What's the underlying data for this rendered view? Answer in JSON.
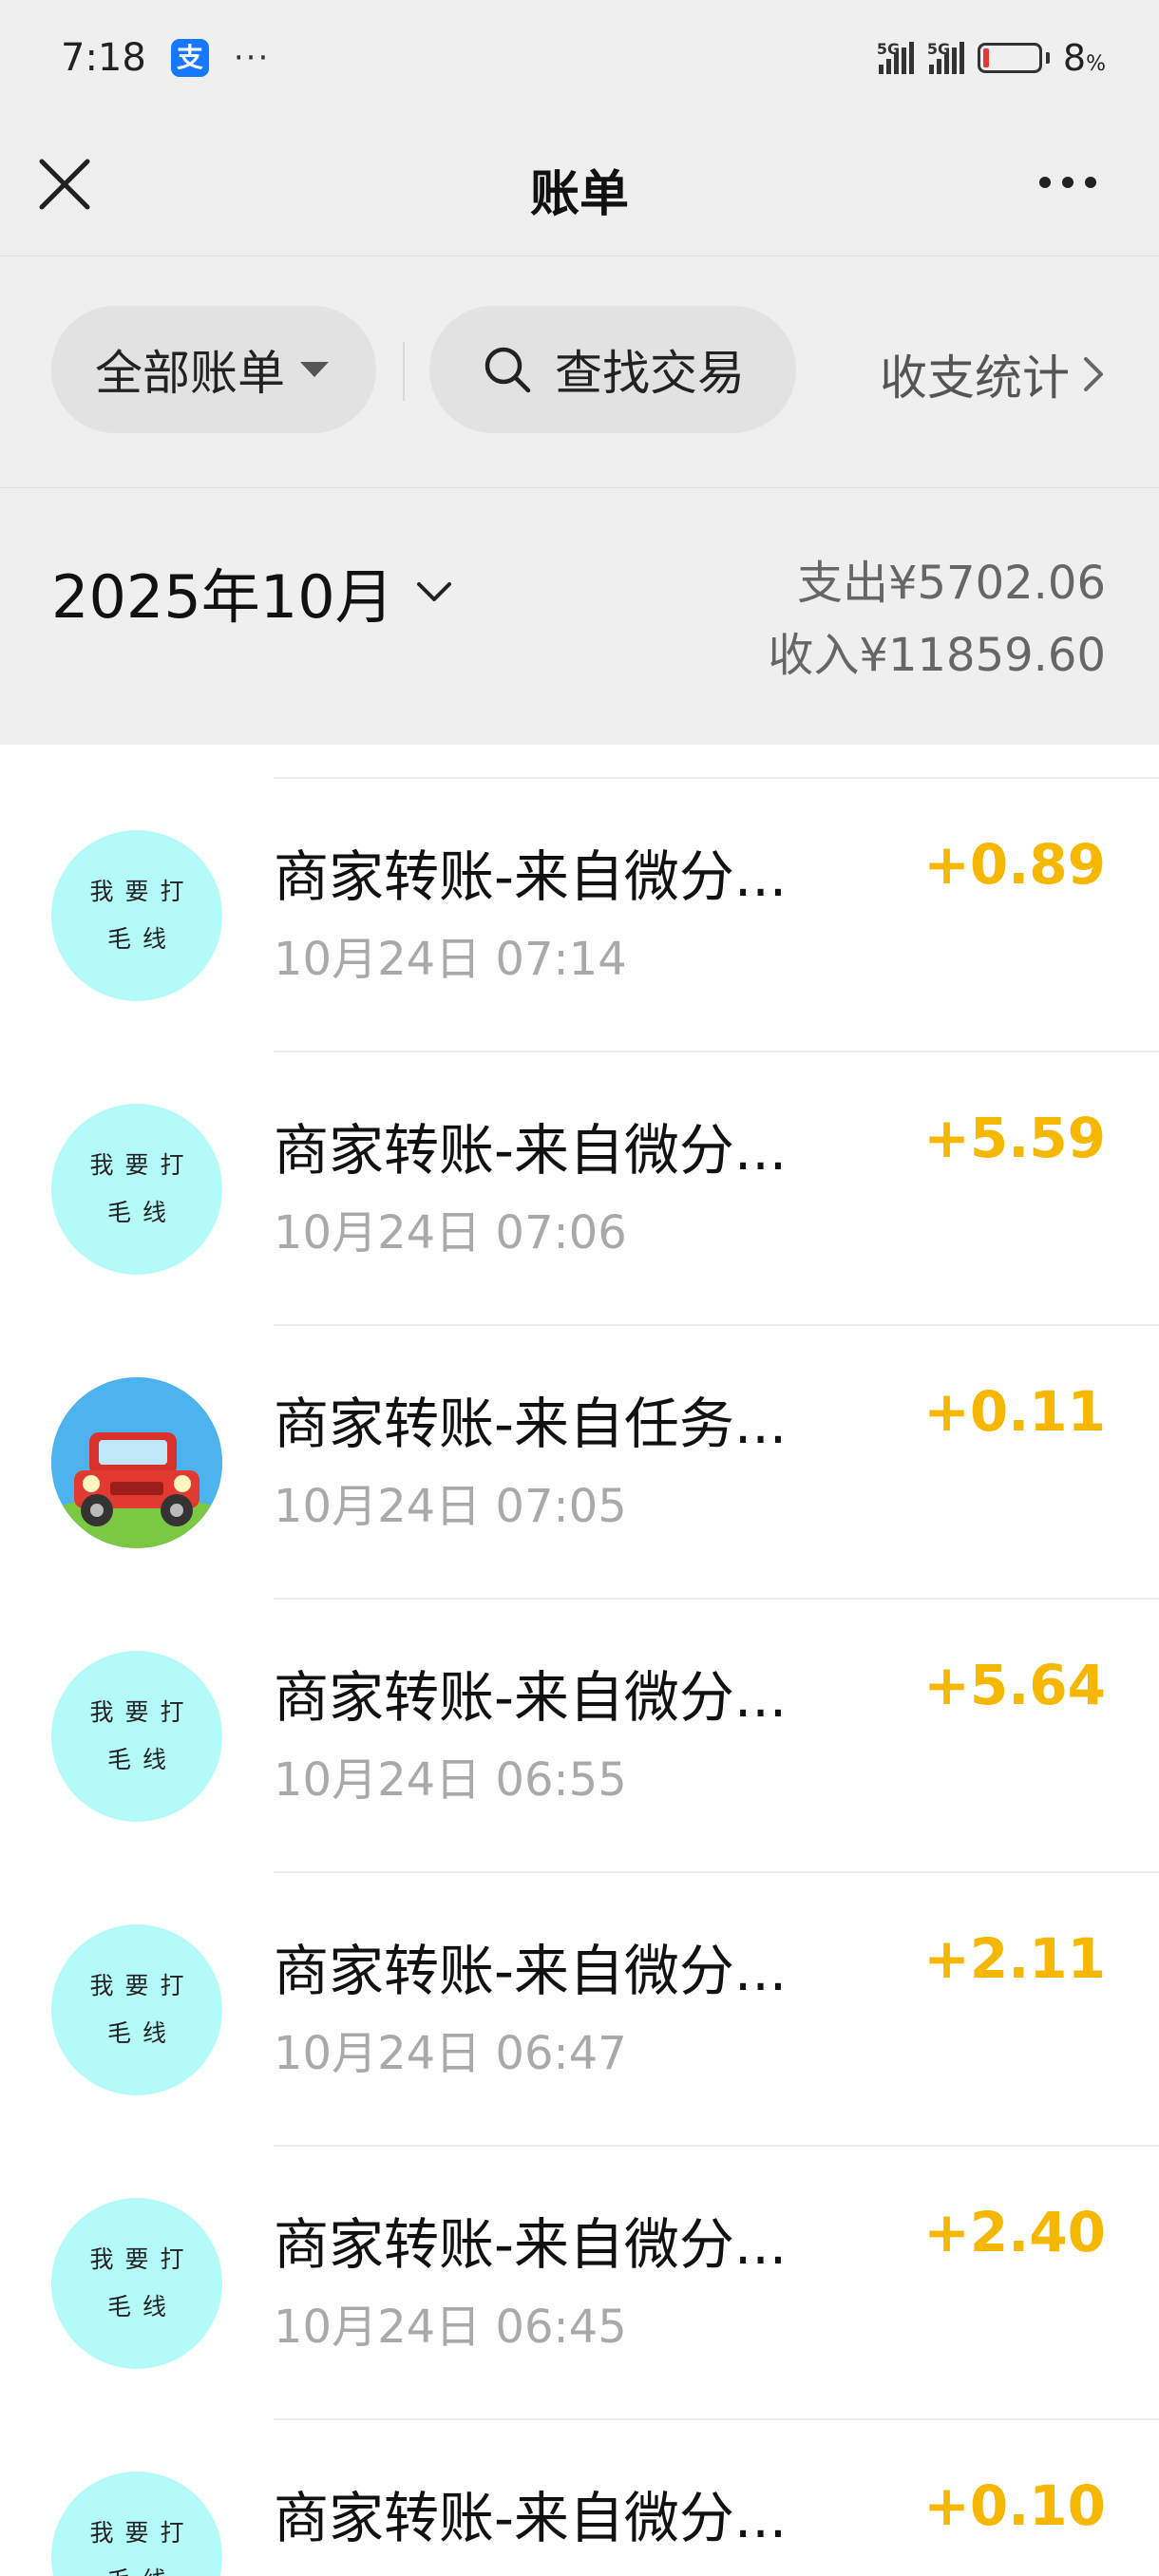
{
  "status_bar": {
    "time": "7:18",
    "app_icon_glyph": "支",
    "more": "···",
    "network_1": "5G",
    "network_2": "5G",
    "battery_value": "8",
    "battery_unit": "%"
  },
  "nav": {
    "title": "账单",
    "close_icon": "close-icon",
    "more_icon": "more-icon"
  },
  "filters": {
    "all_bills": "全部账单",
    "search": "查找交易",
    "stats": "收支统计"
  },
  "month": {
    "label": "2025年10月",
    "expense": "支出¥5702.06",
    "income": "收入¥11859.60"
  },
  "transactions": [
    {
      "avatar_line1": "我要打",
      "avatar_line2": "毛线",
      "title": "商家转账-来自微分...",
      "time": "10月24日 07:14",
      "amount": "+0.89"
    },
    {
      "avatar_line1": "我要打",
      "avatar_line2": "毛线",
      "title": "商家转账-来自微分...",
      "time": "10月24日 07:06",
      "amount": "+5.59"
    },
    {
      "avatar_icon": "car-icon",
      "title": "商家转账-来自任务...",
      "time": "10月24日 07:05",
      "amount": "+0.11"
    },
    {
      "avatar_line1": "我要打",
      "avatar_line2": "毛线",
      "title": "商家转账-来自微分...",
      "time": "10月24日 06:55",
      "amount": "+5.64"
    },
    {
      "avatar_line1": "我要打",
      "avatar_line2": "毛线",
      "title": "商家转账-来自微分...",
      "time": "10月24日 06:47",
      "amount": "+2.11"
    },
    {
      "avatar_line1": "我要打",
      "avatar_line2": "毛线",
      "title": "商家转账-来自微分...",
      "time": "10月24日 06:45",
      "amount": "+2.40"
    },
    {
      "avatar_line1": "我要打",
      "avatar_line2": "毛线",
      "title": "商家转账-来自微分...",
      "time": "",
      "amount": "+0.10"
    }
  ],
  "colors": {
    "income_amount": "#f5b700",
    "header_bg": "#efefef",
    "avatar_bg": "#b3faf8"
  }
}
